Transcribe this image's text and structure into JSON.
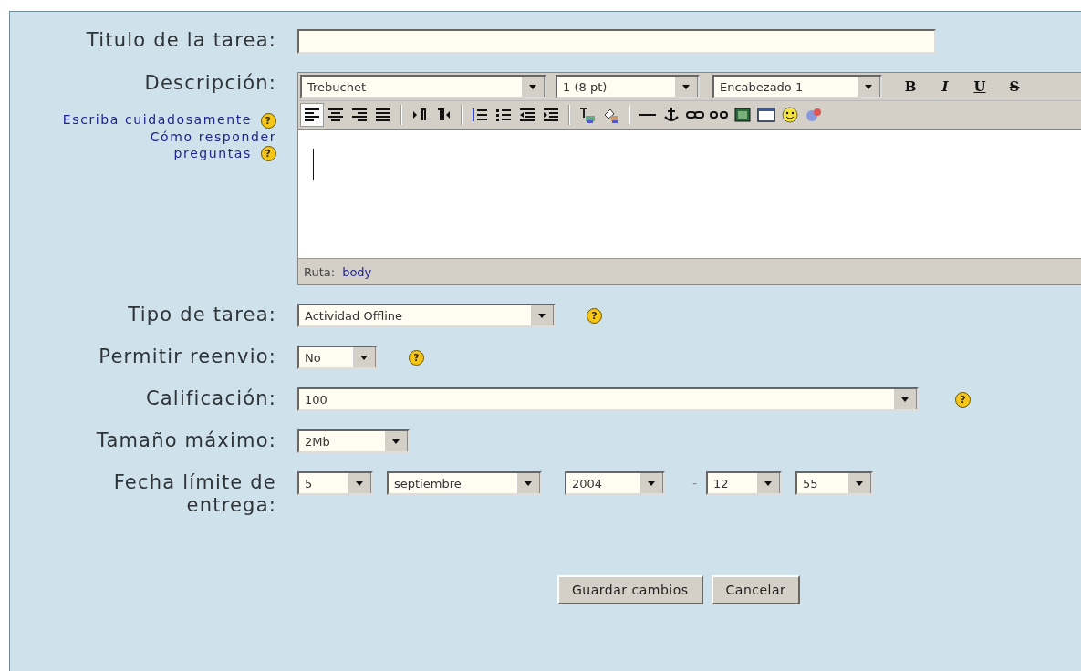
{
  "fields": [
    {
      "kind": "text",
      "label": "Titulo de la tarea:"
    },
    {
      "kind": "editor",
      "label": "Descripción:",
      "help_links": [
        {
          "text": "Escriba cuidadosamente",
          "help": "?"
        },
        {
          "text": "Cómo responder preguntas",
          "help": "?"
        }
      ],
      "font_select": "Trebuchet",
      "size_select": "1 (8 pt)",
      "format_select": "Encabezado 1",
      "format_buttons": [
        {
          "label": "B",
          "kind": "bold"
        },
        {
          "label": "I",
          "kind": "italic"
        },
        {
          "label": "U",
          "kind": "underline"
        },
        {
          "label": "S",
          "kind": "strike"
        }
      ],
      "toolbar": [
        {
          "kind": "align-left",
          "pressed": true
        },
        {
          "kind": "align-center",
          "pressed": false
        },
        {
          "kind": "align-right",
          "pressed": false
        },
        {
          "kind": "align-justify",
          "pressed": false
        },
        {
          "kind": "sep"
        },
        {
          "kind": "ltr",
          "pressed": false
        },
        {
          "kind": "rtl",
          "pressed": false
        },
        {
          "kind": "sep"
        },
        {
          "kind": "ordered-list",
          "pressed": false
        },
        {
          "kind": "bullet-list",
          "pressed": false
        },
        {
          "kind": "outdent",
          "pressed": false
        },
        {
          "kind": "indent",
          "pressed": false
        },
        {
          "kind": "sep"
        },
        {
          "kind": "text-color",
          "pressed": false
        },
        {
          "kind": "bg-color",
          "pressed": false
        },
        {
          "kind": "sep"
        },
        {
          "kind": "hr",
          "pressed": false
        },
        {
          "kind": "anchor",
          "pressed": false
        },
        {
          "kind": "link",
          "pressed": false
        },
        {
          "kind": "unlink",
          "pressed": false
        },
        {
          "kind": "image",
          "pressed": false
        },
        {
          "kind": "table",
          "pressed": false
        },
        {
          "kind": "smiley",
          "pressed": false
        },
        {
          "kind": "special-char",
          "pressed": false
        }
      ],
      "path_label": "Ruta:",
      "path_value": "body"
    },
    {
      "kind": "select",
      "label": "Tipo de tarea:",
      "value": "Actividad Offline",
      "help": "?"
    },
    {
      "kind": "select",
      "label": "Permitir reenvio:",
      "value": "No",
      "help": "?"
    },
    {
      "kind": "select",
      "label": "Calificación:",
      "value": "100",
      "help": "?"
    },
    {
      "kind": "select",
      "label": "Tamaño máximo:",
      "value": "2Mb"
    },
    {
      "kind": "date",
      "label": "Fecha límite de entrega:",
      "selects": [
        "5",
        "septiembre",
        "2004"
      ],
      "separator": "-",
      "time": [
        "12",
        "55"
      ]
    }
  ],
  "buttons": [
    {
      "label": "Guardar cambios"
    },
    {
      "label": "Cancelar"
    }
  ]
}
